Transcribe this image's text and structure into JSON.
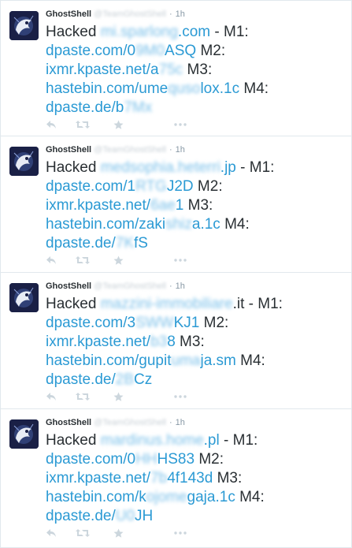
{
  "tweets": [
    {
      "name": "GhostShell",
      "handle": "@TeamGhostShell",
      "time": "1h",
      "lines": [
        [
          {
            "t": "Hacked ",
            "k": "text"
          },
          {
            "t": "mi.sparlong",
            "k": "blur"
          },
          {
            "t": ".com",
            "k": "link"
          },
          {
            "t": " - M1:",
            "k": "text"
          }
        ],
        [
          {
            "t": "dpaste.com/0",
            "k": "link"
          },
          {
            "t": "9M0",
            "k": "blur"
          },
          {
            "t": "ASQ",
            "k": "link"
          },
          {
            "t": " M2:",
            "k": "text"
          }
        ],
        [
          {
            "t": "ixmr.kpaste.net/a",
            "k": "link"
          },
          {
            "t": "75c",
            "k": "blur"
          },
          {
            "t": " M3:",
            "k": "text"
          }
        ],
        [
          {
            "t": "hastebin.com/ume",
            "k": "link"
          },
          {
            "t": "quso",
            "k": "blur"
          },
          {
            "t": "lox.1c",
            "k": "link"
          },
          {
            "t": " M4:",
            "k": "text"
          }
        ],
        [
          {
            "t": "dpaste.de/b",
            "k": "link"
          },
          {
            "t": "7Mx",
            "k": "blur"
          }
        ]
      ]
    },
    {
      "name": "GhostShell",
      "handle": "@TeamGhostShell",
      "time": "1h",
      "lines": [
        [
          {
            "t": "Hacked ",
            "k": "text"
          },
          {
            "t": "medsophia.heterri",
            "k": "blur"
          },
          {
            "t": ".jp",
            "k": "link"
          },
          {
            "t": " - M1:",
            "k": "text"
          }
        ],
        [
          {
            "t": "dpaste.com/1",
            "k": "link"
          },
          {
            "t": "RTG",
            "k": "blur"
          },
          {
            "t": "J2D",
            "k": "link"
          },
          {
            "t": " M2:",
            "k": "text"
          }
        ],
        [
          {
            "t": "ixmr.kpaste.net/",
            "k": "link"
          },
          {
            "t": "6ae",
            "k": "blur"
          },
          {
            "t": "1",
            "k": "link"
          },
          {
            "t": " M3:",
            "k": "text"
          }
        ],
        [
          {
            "t": "hastebin.com/zaki",
            "k": "link"
          },
          {
            "t": "shiz",
            "k": "blur"
          },
          {
            "t": "a.1c",
            "k": "link"
          },
          {
            "t": " M4:",
            "k": "text"
          }
        ],
        [
          {
            "t": "dpaste.de/",
            "k": "link"
          },
          {
            "t": "7K",
            "k": "blur"
          },
          {
            "t": "fS",
            "k": "link"
          }
        ]
      ]
    },
    {
      "name": "GhostShell",
      "handle": "@TeamGhostShell",
      "time": "1h",
      "lines": [
        [
          {
            "t": "Hacked ",
            "k": "text"
          },
          {
            "t": "mazzini-immobiliare",
            "k": "blur"
          },
          {
            "t": ".it - M1:",
            "k": "text"
          }
        ],
        [
          {
            "t": "dpaste.com/3",
            "k": "link"
          },
          {
            "t": "SWW",
            "k": "blur"
          },
          {
            "t": "KJ1",
            "k": "link"
          },
          {
            "t": " M2:",
            "k": "text"
          }
        ],
        [
          {
            "t": "ixmr.kpaste.net/",
            "k": "link"
          },
          {
            "t": "b3",
            "k": "blur"
          },
          {
            "t": "8",
            "k": "link"
          },
          {
            "t": " M3:",
            "k": "text"
          }
        ],
        [
          {
            "t": "hastebin.com/gupit",
            "k": "link"
          },
          {
            "t": "uma",
            "k": "blur"
          },
          {
            "t": "ja.sm",
            "k": "link"
          },
          {
            "t": " M4:",
            "k": "text"
          }
        ],
        [
          {
            "t": "dpaste.de/",
            "k": "link"
          },
          {
            "t": "2B",
            "k": "blur"
          },
          {
            "t": "Cz",
            "k": "link"
          }
        ]
      ]
    },
    {
      "name": "GhostShell",
      "handle": "@TeamGhostShell",
      "time": "1h",
      "lines": [
        [
          {
            "t": "Hacked ",
            "k": "text"
          },
          {
            "t": "mardinus.home",
            "k": "blur"
          },
          {
            "t": ".pl",
            "k": "link"
          },
          {
            "t": " - M1:",
            "k": "text"
          }
        ],
        [
          {
            "t": "dpaste.com/0",
            "k": "link"
          },
          {
            "t": "HH",
            "k": "blur"
          },
          {
            "t": "HS83",
            "k": "link"
          },
          {
            "t": " M2:",
            "k": "text"
          }
        ],
        [
          {
            "t": "ixmr.kpaste.net/",
            "k": "link"
          },
          {
            "t": "7b",
            "k": "blur"
          },
          {
            "t": "4f143d",
            "k": "link"
          },
          {
            "t": " M3:",
            "k": "text"
          }
        ],
        [
          {
            "t": "hastebin.com/k",
            "k": "link"
          },
          {
            "t": "ojome",
            "k": "blur"
          },
          {
            "t": "gaja.1c",
            "k": "link"
          },
          {
            "t": " M4:",
            "k": "text"
          }
        ],
        [
          {
            "t": "dpaste.de/",
            "k": "link"
          },
          {
            "t": "U0",
            "k": "blur"
          },
          {
            "t": "JH",
            "k": "link"
          }
        ]
      ]
    }
  ],
  "icons": [
    "reply-icon",
    "retweet-icon",
    "favorite-icon",
    "more-icon"
  ],
  "colors": {
    "link": "#2b9ad4",
    "text": "#292f33",
    "meta": "#8899a6",
    "icon": "#ccd6dd",
    "border": "#e1e8ed"
  }
}
